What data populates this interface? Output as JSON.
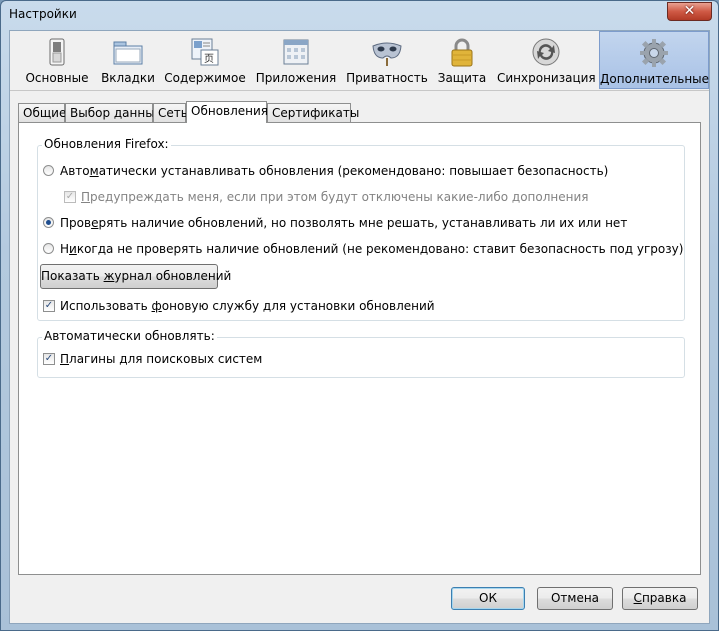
{
  "window": {
    "title": "Настройки",
    "close_glyph": "✕"
  },
  "toolbar": {
    "panes": [
      {
        "label": "Основные",
        "icon": "switch-icon",
        "selected": false
      },
      {
        "label": "Вкладки",
        "icon": "tabs-icon",
        "selected": false
      },
      {
        "label": "Содержимое",
        "icon": "content-icon",
        "selected": false
      },
      {
        "label": "Приложения",
        "icon": "applications-icon",
        "selected": false
      },
      {
        "label": "Приватность",
        "icon": "mask-icon",
        "selected": false
      },
      {
        "label": "Защита",
        "icon": "lock-icon",
        "selected": false
      },
      {
        "label": "Синхронизация",
        "icon": "sync-icon",
        "selected": false
      },
      {
        "label": "Дополнительные",
        "icon": "gear-icon",
        "selected": true
      }
    ]
  },
  "tabs": [
    {
      "label": "Общие",
      "active": false
    },
    {
      "label": "Выбор данных",
      "active": false
    },
    {
      "label": "Сеть",
      "active": false
    },
    {
      "label": "Обновления",
      "active": true
    },
    {
      "label": "Сертификаты",
      "active": false
    }
  ],
  "updates_group": {
    "legend": "Обновления Firefox:",
    "auto_install": {
      "pre": "Авто",
      "key": "м",
      "post": "атически устанавливать обновления (рекомендовано: повышает безопасность)",
      "checked": false
    },
    "warn_addons": {
      "pre": "",
      "key": "П",
      "post": "редупреждать меня, если при этом будут отключены какие-либо дополнения",
      "checked": true,
      "disabled": true
    },
    "check_ask": {
      "pre": "Пров",
      "key": "е",
      "post": "рять наличие обновлений, но позволять мне решать, устанавливать ли их или нет",
      "checked": true
    },
    "never_check": {
      "pre": "Н",
      "key": "и",
      "post": "когда не проверять наличие обновлений (не рекомендовано: ставит безопасность под угрозу)",
      "checked": false
    },
    "history_button": {
      "pre": "Показать ",
      "key": "ж",
      "post": "урнал обновлений"
    },
    "background_service": {
      "pre": "Использовать ",
      "key": "ф",
      "post": "оновую службу для установки обновлений",
      "checked": true
    }
  },
  "auto_update_group": {
    "legend": "Автоматически обновлять:",
    "search_plugins": {
      "pre": "",
      "key": "П",
      "post": "лагины для поисковых систем",
      "checked": true
    }
  },
  "footer": {
    "ok": "ОК",
    "cancel": "Отмена",
    "help": {
      "pre": "",
      "key": "С",
      "post": "правка"
    }
  },
  "colors": {
    "selected_pane": "#b5cbeb",
    "radio_dot": "#1f4e8f",
    "close_button": "#c9503b"
  }
}
